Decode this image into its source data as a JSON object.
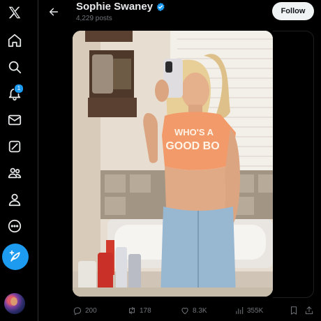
{
  "sidebar": {
    "logo": "x-logo-icon",
    "items": [
      {
        "name": "home",
        "icon": "home-icon"
      },
      {
        "name": "explore",
        "icon": "search-icon"
      },
      {
        "name": "notifications",
        "icon": "bell-icon",
        "badge": "1"
      },
      {
        "name": "messages",
        "icon": "envelope-icon"
      },
      {
        "name": "grok",
        "icon": "grok-icon"
      },
      {
        "name": "communities",
        "icon": "people-icon"
      },
      {
        "name": "profile",
        "icon": "person-icon"
      },
      {
        "name": "more",
        "icon": "more-circle-icon"
      }
    ],
    "post_button_icon": "feather-plus-icon"
  },
  "header": {
    "title": "Sophie Swaney",
    "subtitle": "4,229 posts",
    "follow_label": "Follow"
  },
  "media": {
    "shirt_text_line1": "WHO'S A",
    "shirt_text_line2": "GOOD BO"
  },
  "actions": {
    "replies": "200",
    "reposts": "178",
    "likes": "8.3K",
    "views": "355K"
  },
  "colors": {
    "accent": "#1d9bf0",
    "text": "#e7e9ea",
    "muted": "#71767b",
    "background": "#000000"
  }
}
